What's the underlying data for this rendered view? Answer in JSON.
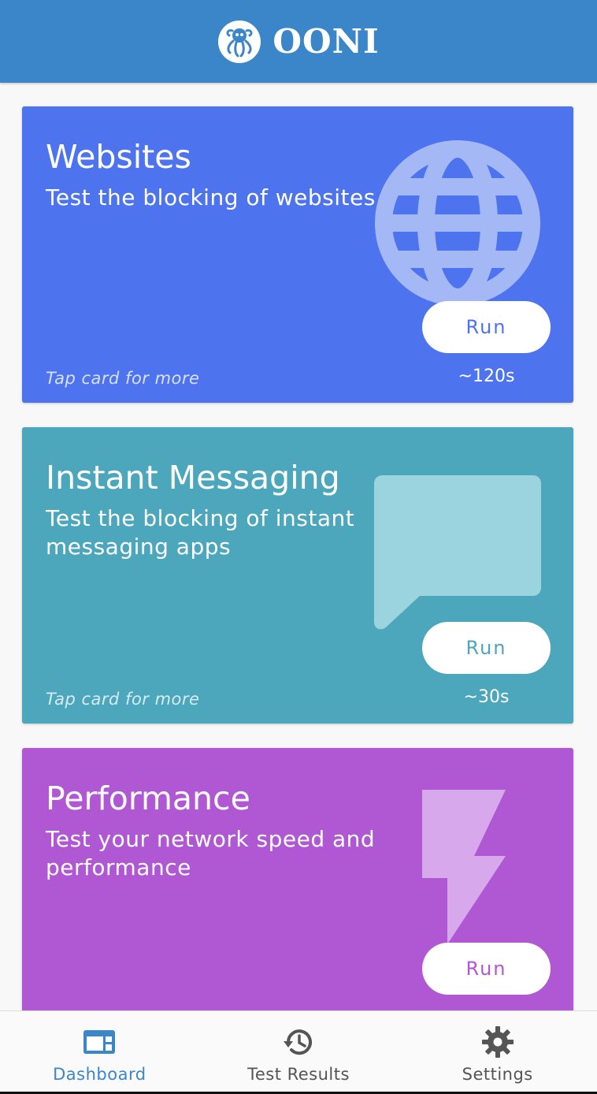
{
  "app": {
    "name": "OONI",
    "colors": {
      "header": "#3a86c8",
      "websites": "#4d74ee",
      "instant_messaging": "#4ca6bc",
      "performance": "#b058d4"
    }
  },
  "cards": [
    {
      "id": "websites",
      "title": "Websites",
      "description": "Test the blocking of websites",
      "icon": "globe-icon",
      "run_label": "Run",
      "tap_hint": "Tap card for more",
      "duration": "~120s"
    },
    {
      "id": "instant-messaging",
      "title": "Instant Messaging",
      "description": "Test the blocking of instant messaging apps",
      "icon": "chat-bubble-icon",
      "run_label": "Run",
      "tap_hint": "Tap card for more",
      "duration": "~30s"
    },
    {
      "id": "performance",
      "title": "Performance",
      "description": "Test your network speed and performance",
      "icon": "lightning-icon",
      "run_label": "Run"
    }
  ],
  "nav": [
    {
      "label": "Dashboard",
      "icon": "dashboard-icon",
      "active": true
    },
    {
      "label": "Test Results",
      "icon": "history-icon",
      "active": false
    },
    {
      "label": "Settings",
      "icon": "gear-icon",
      "active": false
    }
  ]
}
